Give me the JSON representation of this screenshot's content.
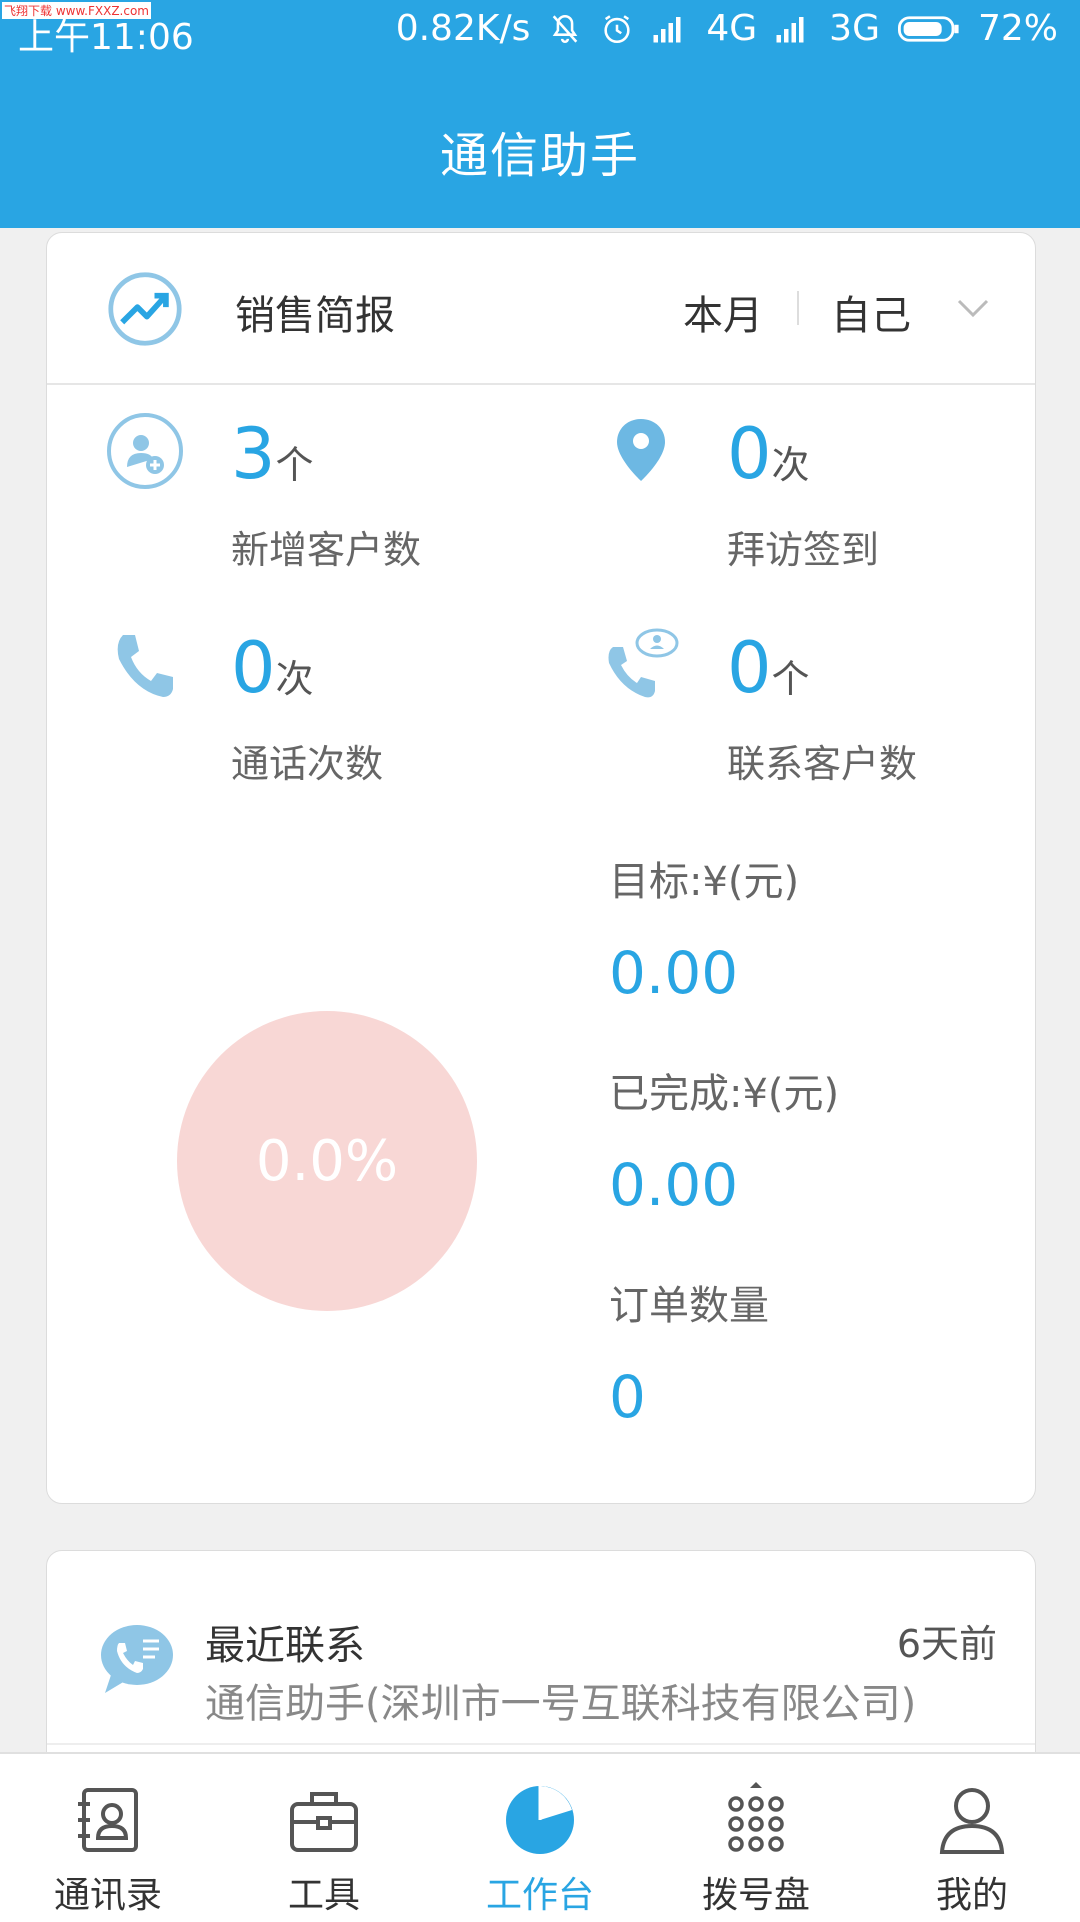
{
  "status_bar": {
    "time": "上午11:06",
    "net_speed": "0.82K/s",
    "net1": "4G",
    "net2": "3G",
    "battery": "72%",
    "watermark": "飞翔下载 www.FXXZ.com"
  },
  "header": {
    "title": "通信助手"
  },
  "sales_report": {
    "title": "销售简报",
    "period": "本月",
    "scope": "自己",
    "stats": [
      {
        "value": "3",
        "unit": "个",
        "label": "新增客户数",
        "icon": "add-customer-icon"
      },
      {
        "value": "0",
        "unit": "次",
        "label": "拜访签到",
        "icon": "location-pin-icon"
      },
      {
        "value": "0",
        "unit": "次",
        "label": "通话次数",
        "icon": "phone-icon"
      },
      {
        "value": "0",
        "unit": "个",
        "label": "联系客户数",
        "icon": "contact-call-icon"
      }
    ],
    "progress_percent": "0.0%",
    "progress_fraction": 0.0,
    "target_label": "目标:¥(元)",
    "target_value": "0.00",
    "completed_label": "已完成:¥(元)",
    "completed_value": "0.00",
    "orders_label": "订单数量",
    "orders_value": "0"
  },
  "recent_contact": {
    "title": "最近联系",
    "time": "6天前",
    "subtitle": "通信助手(深圳市一号互联科技有限公司)"
  },
  "tabs": [
    {
      "label": "通讯录",
      "icon": "contacts-icon"
    },
    {
      "label": "工具",
      "icon": "toolbox-icon"
    },
    {
      "label": "工作台",
      "icon": "workbench-pie-icon",
      "active": true
    },
    {
      "label": "拨号盘",
      "icon": "dialpad-icon"
    },
    {
      "label": "我的",
      "icon": "profile-icon"
    }
  ],
  "colors": {
    "primary": "#29a5e3",
    "pie": "#f8d7d5"
  }
}
